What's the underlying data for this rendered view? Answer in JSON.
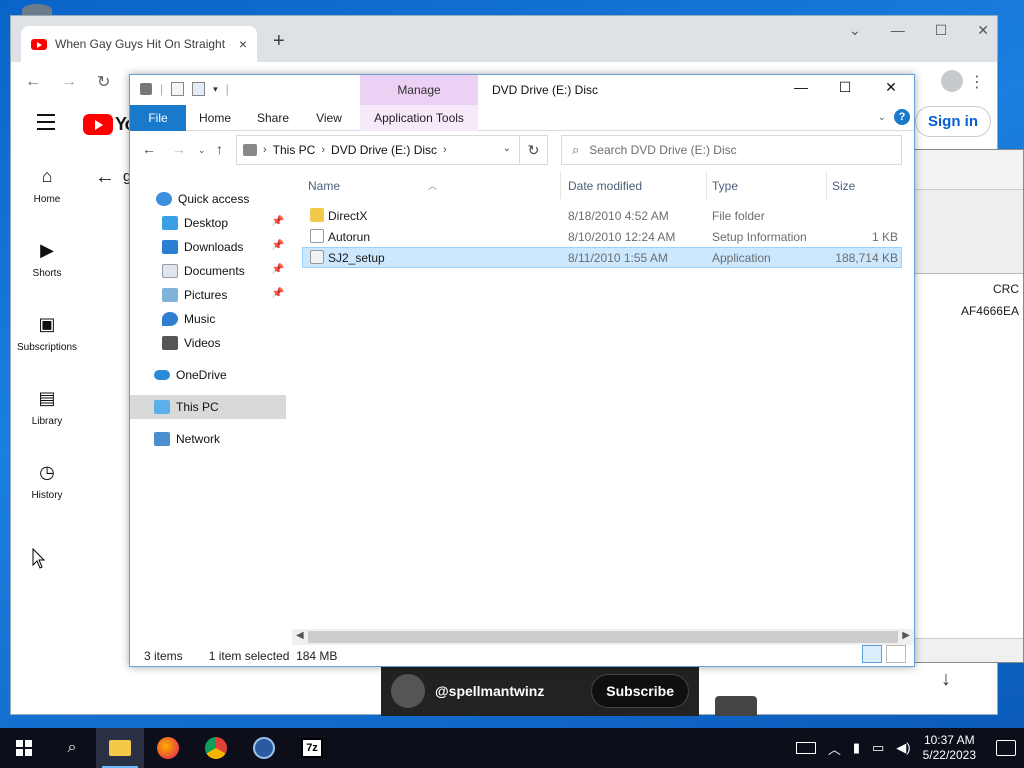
{
  "chrome": {
    "tab_title": "When Gay Guys Hit On Straight",
    "tab_close": "×",
    "new_tab": "+",
    "window_controls": [
      "⌄",
      "—",
      "☐",
      "✕"
    ],
    "yt_logo_text": "Yo",
    "sign_in": "Sign in",
    "back_char": "g",
    "nav": [
      {
        "icon": "home-icon",
        "glyph": "⌂",
        "label": "Home"
      },
      {
        "icon": "shorts-icon",
        "glyph": "▶",
        "label": "Shorts"
      },
      {
        "icon": "subscriptions-icon",
        "glyph": "▣",
        "label": "Subscriptions"
      },
      {
        "icon": "library-icon",
        "glyph": "▤",
        "label": "Library"
      },
      {
        "icon": "history-icon",
        "glyph": "◷",
        "label": "History"
      }
    ],
    "video_handle": "@spellmantwinz",
    "subscribe": "Subscribe"
  },
  "sevenzip": {
    "crc_header": "CRC",
    "crc_value": "AF4666EA"
  },
  "explorer": {
    "title": "DVD Drive (E:) Disc",
    "manage_tab": "Manage",
    "ribbon_tabs": {
      "file": "File",
      "home": "Home",
      "share": "Share",
      "view": "View",
      "app_tools": "Application Tools"
    },
    "window_controls": {
      "minimize": "—",
      "maximize": "☐",
      "close": "✕"
    },
    "help": "?",
    "breadcrumb": [
      "This PC",
      "DVD Drive (E:) Disc"
    ],
    "search_placeholder": "Search DVD Drive (E:) Disc",
    "nav_pane": {
      "quick_access": "Quick access",
      "desktop": "Desktop",
      "downloads": "Downloads",
      "documents": "Documents",
      "pictures": "Pictures",
      "music": "Music",
      "videos": "Videos",
      "onedrive": "OneDrive",
      "this_pc": "This PC",
      "network": "Network"
    },
    "columns": {
      "name": "Name",
      "date": "Date modified",
      "type": "Type",
      "size": "Size"
    },
    "files": [
      {
        "name": "DirectX",
        "date": "8/18/2010 4:52 AM",
        "type": "File folder",
        "size": "",
        "icon": "folder-icon",
        "color": "#f3c94a"
      },
      {
        "name": "Autorun",
        "date": "8/10/2010 12:24 AM",
        "type": "Setup Information",
        "size": "1 KB",
        "icon": "setup-info-icon",
        "color": "#c9c9c9"
      },
      {
        "name": "SJ2_setup",
        "date": "8/11/2010 1:55 AM",
        "type": "Application",
        "size": "188,714 KB",
        "icon": "application-icon",
        "color": "#e8e8e8"
      }
    ],
    "status": {
      "items": "3 items",
      "selected": "1 item selected  184 MB"
    }
  },
  "taskbar": {
    "time": "10:37 AM",
    "date": "5/22/2023"
  }
}
